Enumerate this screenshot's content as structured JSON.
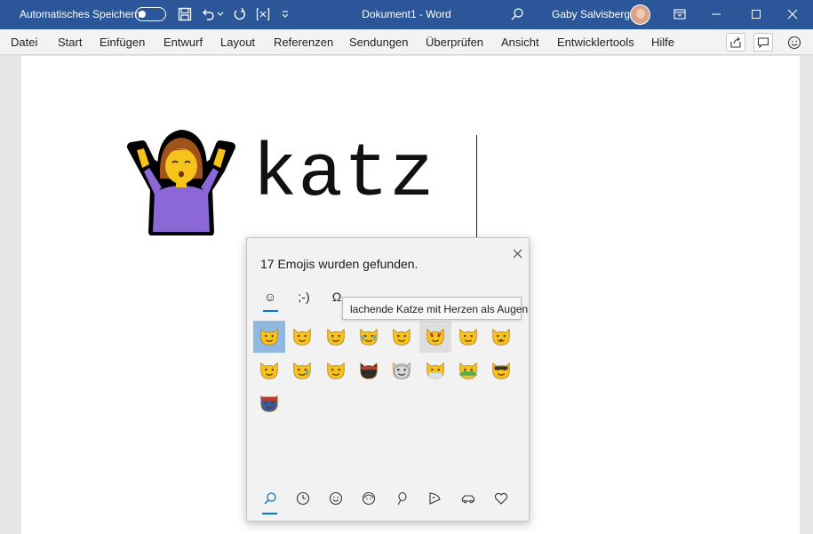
{
  "titlebar": {
    "autosave_label": "Automatisches Speichern",
    "document_title": "Dokument1 - Word",
    "user_name": "Gaby Salvisberg",
    "background_color": "#2b579a",
    "icons": [
      "autosave-toggle",
      "save-icon",
      "undo-icon",
      "undo-dropdown-icon",
      "redo-icon",
      "layout-icon",
      "customize-dropdown-icon",
      "search-icon",
      "ribbon-display-icon",
      "minimize-icon",
      "maximize-icon",
      "close-icon"
    ]
  },
  "menu": {
    "tabs": [
      "Datei",
      "Start",
      "Einfügen",
      "Entwurf",
      "Layout",
      "Referenzen",
      "Sendungen",
      "Überprüfen",
      "Ansicht",
      "Entwicklertools",
      "Hilfe"
    ],
    "icons": [
      "share-icon",
      "comments-icon",
      "feedback-smiley-icon"
    ]
  },
  "document": {
    "emoji": "person-shrugging",
    "text": "katz"
  },
  "emoji_panel": {
    "found_label": "17 Emojis wurden gefunden.",
    "category_tabs": [
      {
        "name": "emoji",
        "label": "☺"
      },
      {
        "name": "kaomoji",
        "label": ";-)"
      },
      {
        "name": "symbols",
        "label": "Ω"
      }
    ],
    "tooltip": "lachende Katze mit Herzen als Augen",
    "results": [
      {
        "name": "cat-face",
        "state": "selected"
      },
      {
        "name": "cat"
      },
      {
        "name": "grinning-cat"
      },
      {
        "name": "cat-with-tears-of-joy"
      },
      {
        "name": "smiling-cat"
      },
      {
        "name": "heart-eyes-cat",
        "state": "hover"
      },
      {
        "name": "wry-smile-cat"
      },
      {
        "name": "kissing-cat"
      },
      {
        "name": "grinning-cat-smiling-eyes"
      },
      {
        "name": "crying-cat"
      },
      {
        "name": "weary-cat"
      },
      {
        "name": "ninja-cat"
      },
      {
        "name": "astro-cat"
      },
      {
        "name": "hacker-cat"
      },
      {
        "name": "dino-cat"
      },
      {
        "name": "hipster-cat"
      },
      {
        "name": "stunt-cat"
      }
    ],
    "bottom_tabs": [
      "search-icon",
      "recent-icon",
      "smiley-icon",
      "people-icon",
      "celebration-icon",
      "food-icon",
      "travel-icon",
      "heart-icon"
    ],
    "accent_color": "#0078d4"
  }
}
